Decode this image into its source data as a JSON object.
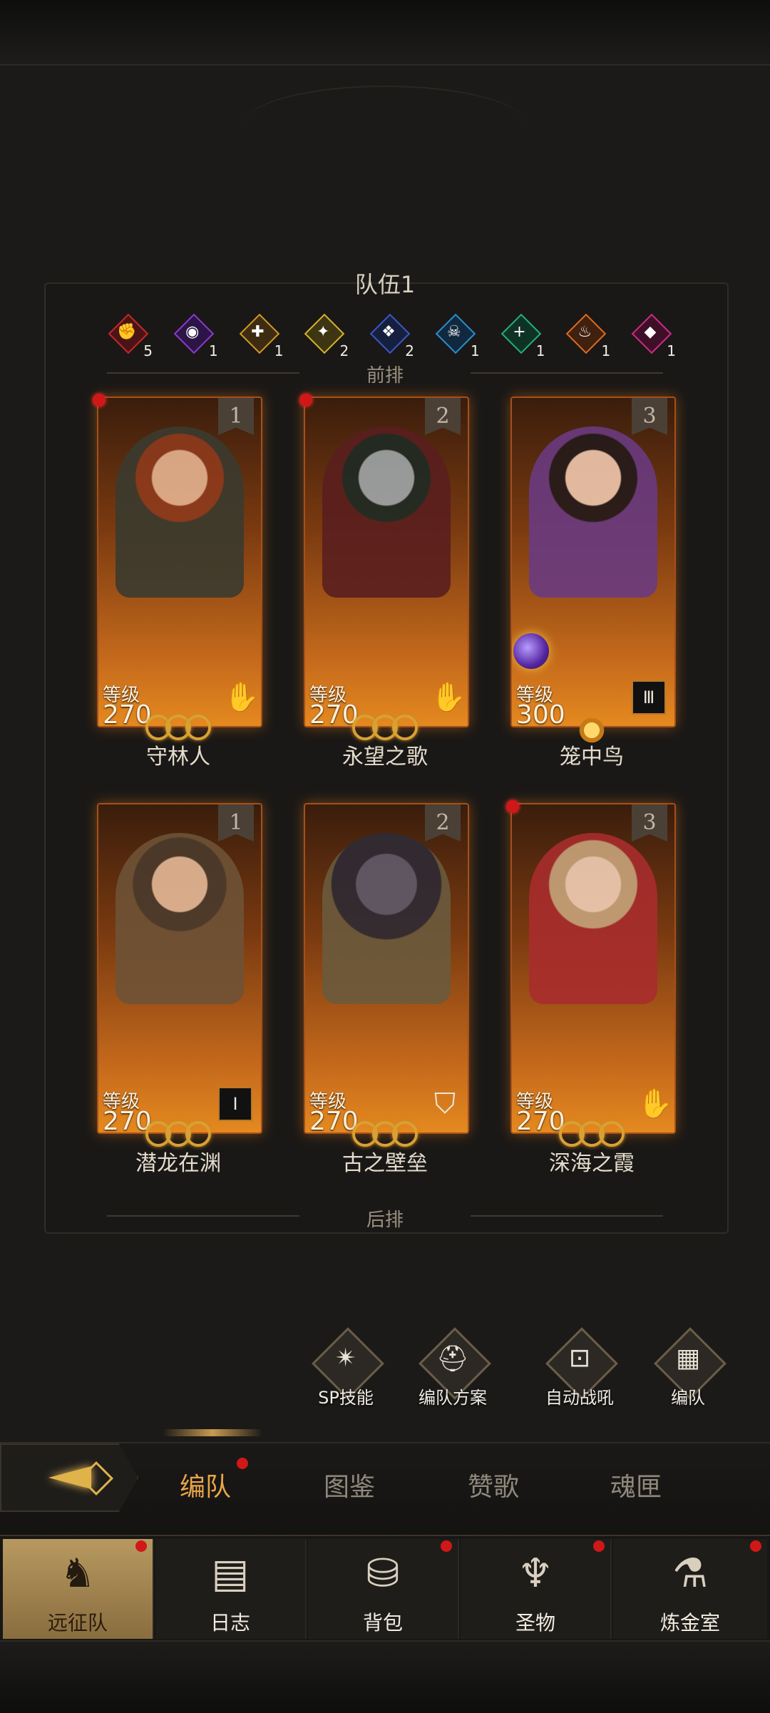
{
  "team": {
    "title": "队伍1",
    "front_label": "前排",
    "back_label": "后排",
    "factions": [
      {
        "icon": "red-fist-icon",
        "glyph": "✊",
        "color": "#c8262a",
        "count": "5"
      },
      {
        "icon": "purple-eye-icon",
        "glyph": "◉",
        "color": "#8a3bd0",
        "count": "1"
      },
      {
        "icon": "gold-cross-icon",
        "glyph": "✚",
        "color": "#d09a24",
        "count": "1"
      },
      {
        "icon": "yellow-figure-icon",
        "glyph": "✦",
        "color": "#d4b42a",
        "count": "2"
      },
      {
        "icon": "blue-beast-icon",
        "glyph": "❖",
        "color": "#3a58c8",
        "count": "2"
      },
      {
        "icon": "cyan-skull-icon",
        "glyph": "☠",
        "color": "#2a8ed0",
        "count": "1"
      },
      {
        "icon": "green-plus-icon",
        "glyph": "+",
        "color": "#22b07a",
        "count": "1"
      },
      {
        "icon": "orange-flame-icon",
        "glyph": "♨",
        "color": "#e06a20",
        "count": "1"
      },
      {
        "icon": "pink-gem-icon",
        "glyph": "◆",
        "color": "#d02a8a",
        "count": "1"
      }
    ],
    "cards": [
      {
        "slot": "1",
        "level_label": "等级",
        "level": "270",
        "name": "守林人",
        "class_icon": "hand-icon",
        "class_glyph": "✋",
        "badge": false
      },
      {
        "slot": "2",
        "level_label": "等级",
        "level": "270",
        "name": "永望之歌",
        "class_icon": "hand-icon",
        "class_glyph": "✋",
        "badge": false
      },
      {
        "slot": "3",
        "level_label": "等级",
        "level": "300",
        "name": "笼中鸟",
        "class_icon": "sword-rank-icon",
        "class_glyph": "Ⅲ",
        "badge": true
      },
      {
        "slot": "1",
        "level_label": "等级",
        "level": "270",
        "name": "潜龙在渊",
        "class_icon": "sword-rank-icon",
        "class_glyph": "Ⅰ",
        "badge": true
      },
      {
        "slot": "2",
        "level_label": "等级",
        "level": "270",
        "name": "古之壁垒",
        "class_icon": "shield-icon",
        "class_glyph": "⛉",
        "badge": false
      },
      {
        "slot": "3",
        "level_label": "等级",
        "level": "270",
        "name": "深海之霞",
        "class_icon": "hand-icon",
        "class_glyph": "✋",
        "badge": false
      }
    ]
  },
  "actions": [
    {
      "label": "SP技能",
      "icon": "sp-star-icon",
      "glyph": "✴"
    },
    {
      "label": "编队方案",
      "icon": "helmet-icon",
      "glyph": "⛑"
    },
    {
      "label": "自动战吼",
      "icon": "auto-battle-icon",
      "glyph": "⊡"
    },
    {
      "label": "编队",
      "icon": "formation-icon",
      "glyph": "▦"
    }
  ],
  "sub_tabs": [
    "编队",
    "图鉴",
    "赞歌",
    "魂匣"
  ],
  "bottom_nav": [
    {
      "label": "远征队",
      "icon": "horned-helmet-icon",
      "glyph": "♞"
    },
    {
      "label": "日志",
      "icon": "scroll-icon",
      "glyph": "▤"
    },
    {
      "label": "背包",
      "icon": "backpack-icon",
      "glyph": "⛁"
    },
    {
      "label": "圣物",
      "icon": "brazier-icon",
      "glyph": "♆"
    },
    {
      "label": "炼金室",
      "icon": "alchemy-icon",
      "glyph": "⚗"
    }
  ],
  "colors": {
    "accent": "#e9a54a",
    "notification": "#d01818",
    "card_glow": "#e5891f"
  }
}
